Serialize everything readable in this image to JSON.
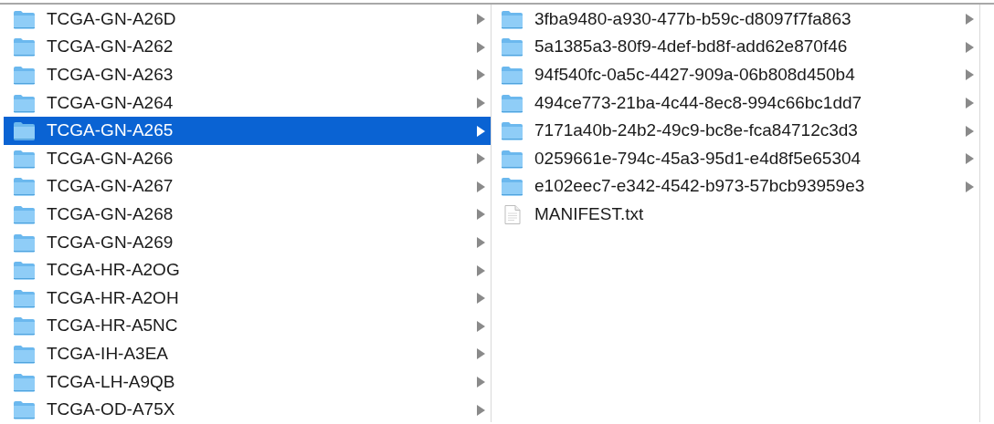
{
  "columns": [
    {
      "items": [
        {
          "name": "TCGA-GN-A26D",
          "kind": "folder",
          "selected": false
        },
        {
          "name": "TCGA-GN-A262",
          "kind": "folder",
          "selected": false
        },
        {
          "name": "TCGA-GN-A263",
          "kind": "folder",
          "selected": false
        },
        {
          "name": "TCGA-GN-A264",
          "kind": "folder",
          "selected": false
        },
        {
          "name": "TCGA-GN-A265",
          "kind": "folder",
          "selected": true
        },
        {
          "name": "TCGA-GN-A266",
          "kind": "folder",
          "selected": false
        },
        {
          "name": "TCGA-GN-A267",
          "kind": "folder",
          "selected": false
        },
        {
          "name": "TCGA-GN-A268",
          "kind": "folder",
          "selected": false
        },
        {
          "name": "TCGA-GN-A269",
          "kind": "folder",
          "selected": false
        },
        {
          "name": "TCGA-HR-A2OG",
          "kind": "folder",
          "selected": false
        },
        {
          "name": "TCGA-HR-A2OH",
          "kind": "folder",
          "selected": false
        },
        {
          "name": "TCGA-HR-A5NC",
          "kind": "folder",
          "selected": false
        },
        {
          "name": "TCGA-IH-A3EA",
          "kind": "folder",
          "selected": false
        },
        {
          "name": "TCGA-LH-A9QB",
          "kind": "folder",
          "selected": false
        },
        {
          "name": "TCGA-OD-A75X",
          "kind": "folder",
          "selected": false
        }
      ]
    },
    {
      "items": [
        {
          "name": "3fba9480-a930-477b-b59c-d8097f7fa863",
          "kind": "folder",
          "selected": false
        },
        {
          "name": "5a1385a3-80f9-4def-bd8f-add62e870f46",
          "kind": "folder",
          "selected": false
        },
        {
          "name": "94f540fc-0a5c-4427-909a-06b808d450b4",
          "kind": "folder",
          "selected": false
        },
        {
          "name": "494ce773-21ba-4c44-8ec8-994c66bc1dd7",
          "kind": "folder",
          "selected": false
        },
        {
          "name": "7171a40b-24b2-49c9-bc8e-fca84712c3d3",
          "kind": "folder",
          "selected": false
        },
        {
          "name": "0259661e-794c-45a3-95d1-e4d8f5e65304",
          "kind": "folder",
          "selected": false
        },
        {
          "name": "e102eec7-e342-4542-b973-57bcb93959e3",
          "kind": "folder",
          "selected": false
        },
        {
          "name": "MANIFEST.txt",
          "kind": "file",
          "selected": false
        }
      ]
    }
  ]
}
